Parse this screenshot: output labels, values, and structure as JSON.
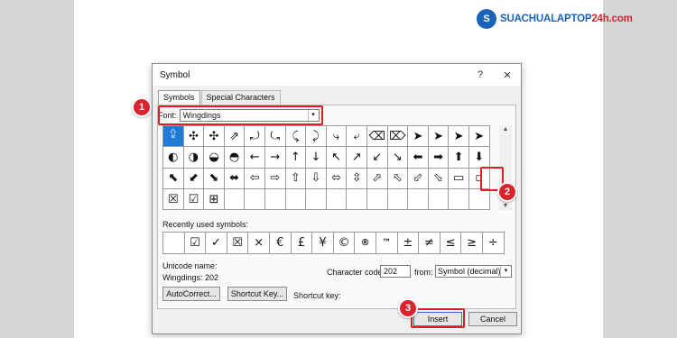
{
  "logo": {
    "mark": "S",
    "part1": "SUACHUA",
    "part2": "LAPTOP",
    "part3": "24h.com"
  },
  "dialog": {
    "title": "Symbol",
    "help_glyph": "?",
    "close_glyph": "✕",
    "tabs": [
      {
        "label": "Symbols",
        "active": true
      },
      {
        "label": "Special Characters",
        "active": false
      }
    ],
    "font_label": "Font:",
    "font_value": "Wingdings",
    "dropdown_glyph": "▾",
    "symbol_rows": [
      [
        "⮸",
        "✣",
        "✣",
        "⇗",
        "⤾",
        "⤿",
        "⤹",
        "⤸",
        "⤷",
        "⤶",
        "⌫",
        "⌦",
        "➤",
        "➤",
        "➤",
        "➤"
      ],
      [
        "◐",
        "◑",
        "◒",
        "◓",
        "←",
        "→",
        "↑",
        "↓",
        "↖",
        "↗",
        "↙",
        "↘",
        "⬅",
        "➡",
        "⬆",
        "⬇"
      ],
      [
        "⬉",
        "⬋",
        "⬊",
        "⬌",
        "⇦",
        "⇨",
        "⇧",
        "⇩",
        "⬄",
        "⇳",
        "⬀",
        "⬁",
        "⬃",
        "⬂",
        "▭",
        "▫",
        "✗",
        "✓"
      ],
      [
        "☒",
        "☑",
        "⊞",
        "",
        "",
        "",
        "",
        "",
        "",
        "",
        "",
        "",
        "",
        "",
        "",
        ""
      ]
    ],
    "recent_label": "Recently used symbols:",
    "recent_symbols": [
      "",
      "☑",
      "✓",
      "☒",
      "×",
      "€",
      "£",
      "¥",
      "©",
      "®",
      "™",
      "±",
      "≠",
      "≤",
      "≥",
      "÷",
      "×"
    ],
    "unicode_name_label": "Unicode name:",
    "unicode_name_value": "Wingdings: 202",
    "char_code_label": "Character code:",
    "char_code_value": "202",
    "from_label": "from:",
    "from_value": "Symbol (decimal)",
    "autocorrect_label": "AutoCorrect...",
    "shortcut_key_button": "Shortcut Key...",
    "shortcut_key_label": "Shortcut key:",
    "insert_label": "Insert",
    "cancel_label": "Cancel"
  },
  "callouts": [
    "1",
    "2",
    "3"
  ],
  "scroll": {
    "up": "▲",
    "down": "▼"
  }
}
